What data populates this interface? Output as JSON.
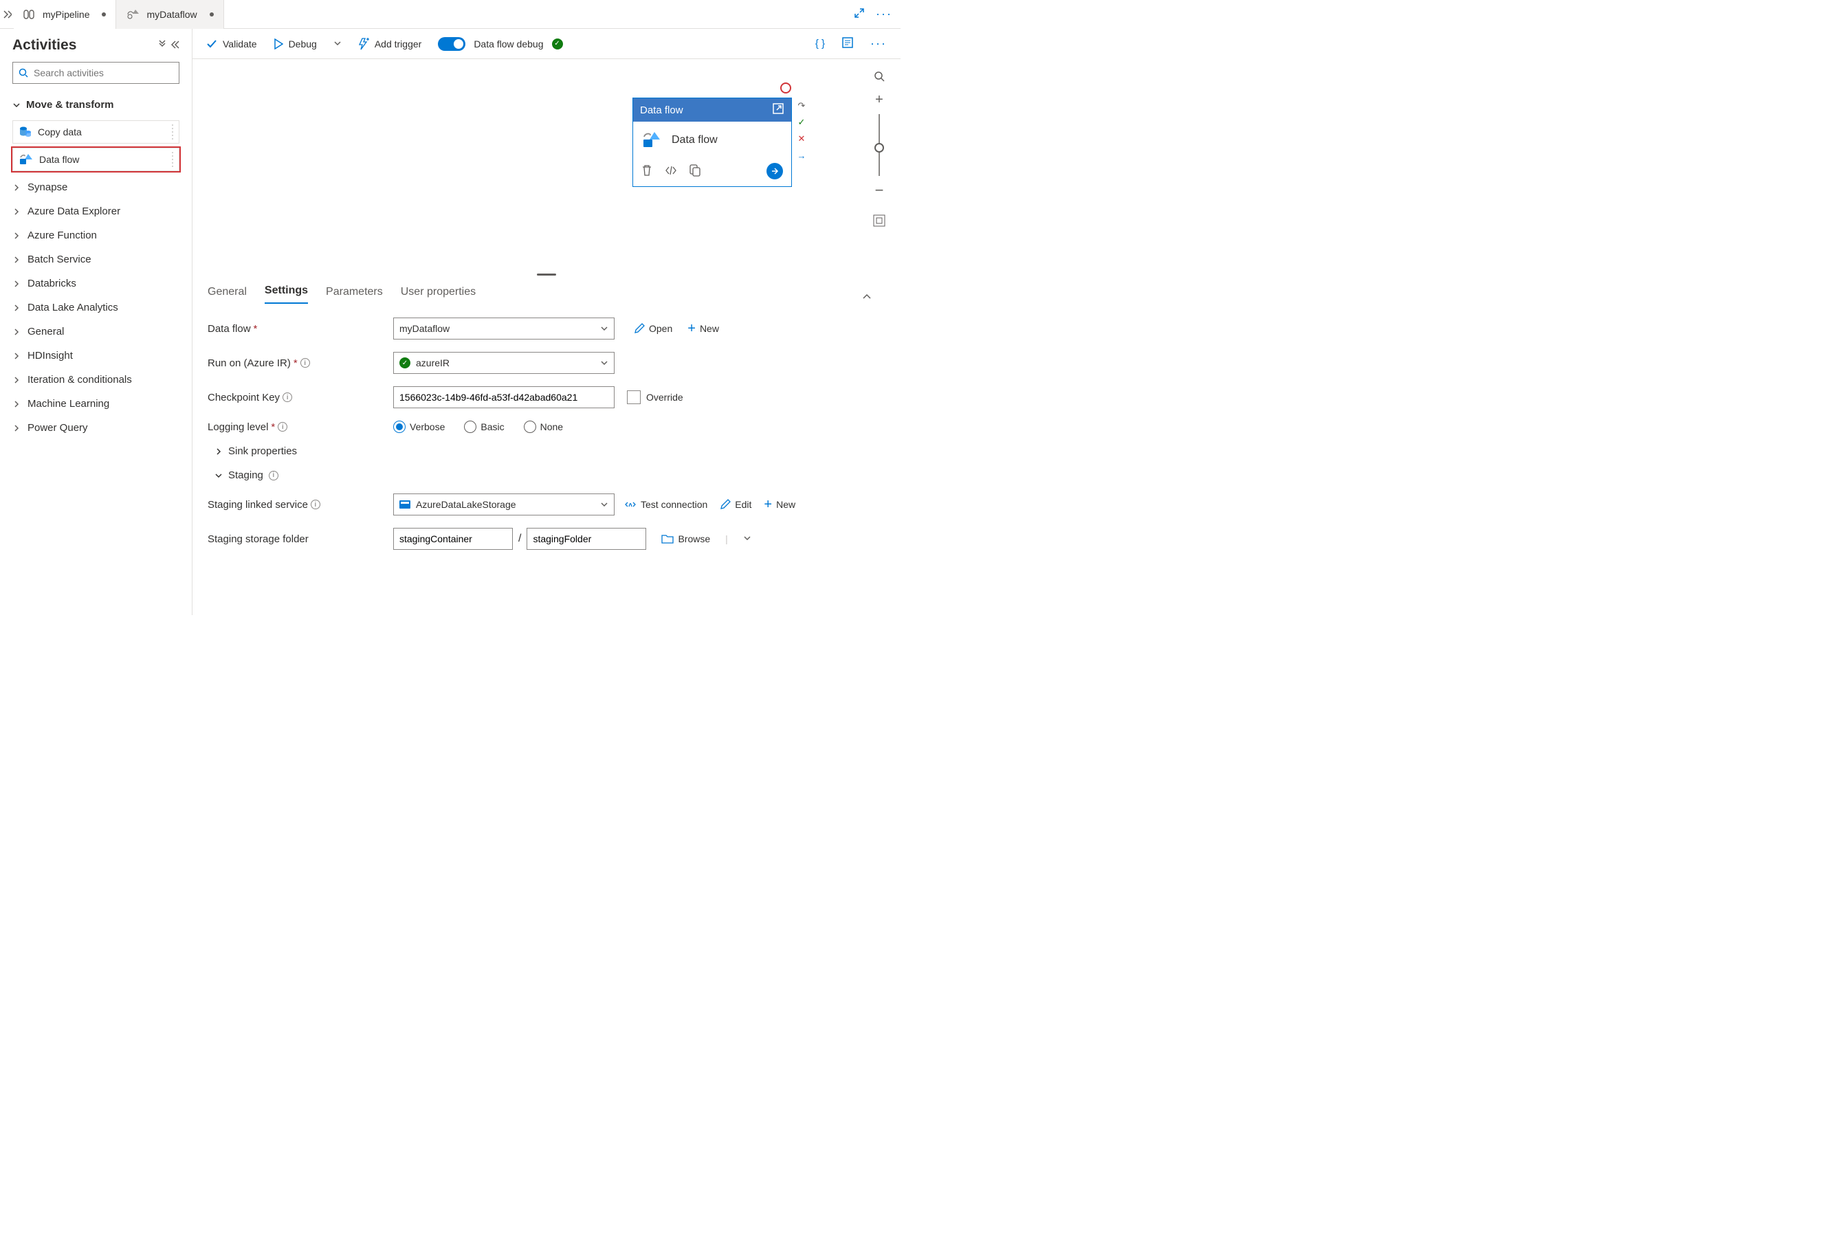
{
  "tabs": [
    {
      "label": "myPipeline",
      "dirty": true
    },
    {
      "label": "myDataflow",
      "dirty": true
    }
  ],
  "sidebar": {
    "title": "Activities",
    "search_placeholder": "Search activities",
    "category_move": "Move & transform",
    "activities": {
      "copy": "Copy data",
      "dataflow": "Data flow"
    },
    "categories": [
      "Synapse",
      "Azure Data Explorer",
      "Azure Function",
      "Batch Service",
      "Databricks",
      "Data Lake Analytics",
      "General",
      "HDInsight",
      "Iteration & conditionals",
      "Machine Learning",
      "Power Query"
    ]
  },
  "toolbar": {
    "validate": "Validate",
    "debug": "Debug",
    "add_trigger": "Add trigger",
    "dataflow_debug": "Data flow debug"
  },
  "node": {
    "title": "Data flow",
    "subtitle": "Data flow"
  },
  "panel": {
    "tabs": {
      "general": "General",
      "settings": "Settings",
      "parameters": "Parameters",
      "user_properties": "User properties"
    },
    "dataflow_label": "Data flow",
    "dataflow_value": "myDataflow",
    "open": "Open",
    "new": "New",
    "runon_label": "Run on (Azure IR)",
    "runon_value": "azureIR",
    "checkpoint_label": "Checkpoint Key",
    "checkpoint_value": "1566023c-14b9-46fd-a53f-d42abad60a21",
    "override": "Override",
    "logging_label": "Logging level",
    "logging_options": {
      "verbose": "Verbose",
      "basic": "Basic",
      "none": "None"
    },
    "sink_props": "Sink properties",
    "staging": "Staging",
    "staging_service_label": "Staging linked service",
    "staging_service_value": "AzureDataLakeStorage",
    "test_conn": "Test connection",
    "edit": "Edit",
    "staging_folder_label": "Staging storage folder",
    "staging_container": "stagingContainer",
    "staging_folder": "stagingFolder",
    "browse": "Browse"
  }
}
